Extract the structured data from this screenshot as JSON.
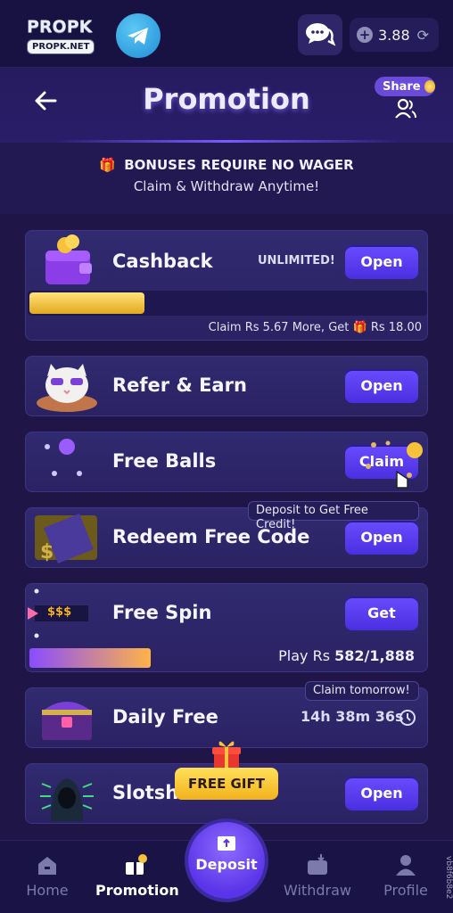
{
  "topbar": {
    "logo_top": "PROPK",
    "logo_bottom": "PROPK.NET",
    "balance": "3.88"
  },
  "header": {
    "title": "Promotion",
    "share_label": "Share"
  },
  "notice": {
    "line1": "BONUSES REQUIRE NO WAGER",
    "line2": "Claim & Withdraw Anytime!"
  },
  "cards": {
    "cashback": {
      "title": "Cashback",
      "tag": "UNLIMITED!",
      "button": "Open",
      "claim_text_prefix": "Claim Rs 5.67 More, Get",
      "claim_text_amount": "Rs 18.00",
      "progress": 0.29
    },
    "refer": {
      "title": "Refer & Earn",
      "button": "Open"
    },
    "free_balls": {
      "title": "Free Balls",
      "button": "Claim"
    },
    "redeem": {
      "title": "Redeem Free Code",
      "button": "Open",
      "tooltip": "Deposit to Get Free Credit!"
    },
    "free_spin": {
      "title": "Free Spin",
      "button": "Get",
      "ticket_text": "$$$",
      "play_prefix": "Play Rs",
      "play_value": "582/1,888",
      "progress": 0.31
    },
    "daily_free": {
      "title": "Daily Free",
      "timer": "14h 38m 36s",
      "tooltip": "Claim tomorrow!"
    },
    "slots": {
      "title": "Slotsh",
      "button": "Open",
      "gift_label": "FREE GIFT"
    }
  },
  "nav": {
    "home": "Home",
    "promotion": "Promotion",
    "deposit": "Deposit",
    "withdraw": "Withdraw",
    "profile": "Profile"
  },
  "side_tag": "vb8f6b8e2",
  "colors": {
    "background": "#1f1647",
    "accent_button": "#5a3cf0",
    "gold": "#f2b21c"
  }
}
